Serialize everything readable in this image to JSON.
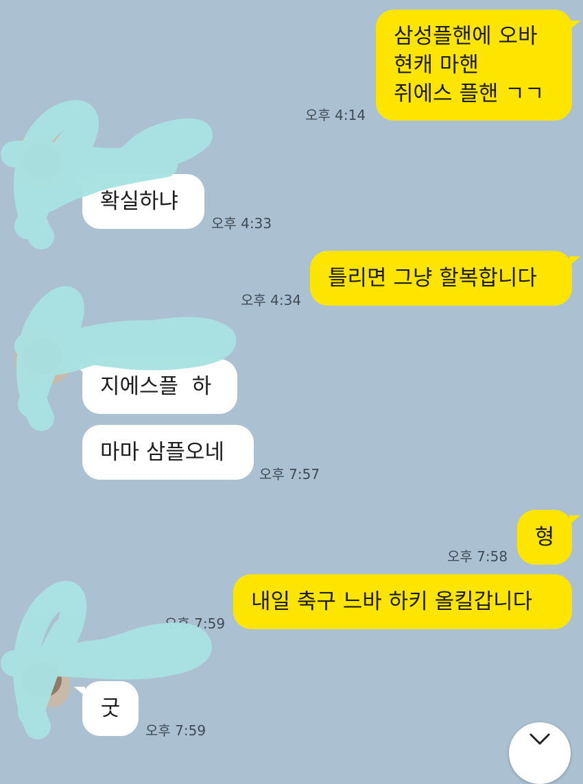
{
  "messages": [
    {
      "side": "mine",
      "lines": [
        "삼성플핸에 오바",
        "현캐 마핸",
        "쥐에스 플핸 ㄱㄱ"
      ],
      "time": "오후 4:14"
    },
    {
      "side": "theirs",
      "text": "확실하냐",
      "time": "오후 4:33"
    },
    {
      "side": "mine",
      "text": "틀리면 그냥 할복합니다",
      "time": "오후 4:34"
    },
    {
      "side": "theirs",
      "text": "지에스플  하"
    },
    {
      "side": "theirs",
      "text": "마마 삼플오네",
      "time": "오후 7:57"
    },
    {
      "side": "mine",
      "text": "형",
      "time": "오후 7:58"
    },
    {
      "side": "mine",
      "text": "내일 축구 느바 하키 올킬갑니다",
      "time": "오후 7:59"
    },
    {
      "side": "theirs",
      "text": "굿",
      "time": "오후 7:59"
    }
  ],
  "colors": {
    "background": "#abc1d1",
    "mine_bubble": "#fee500",
    "theirs_bubble": "#ffffff",
    "scribble": "#a9e2e2"
  },
  "icons": {
    "scroll_down": "chevron-down-icon"
  }
}
